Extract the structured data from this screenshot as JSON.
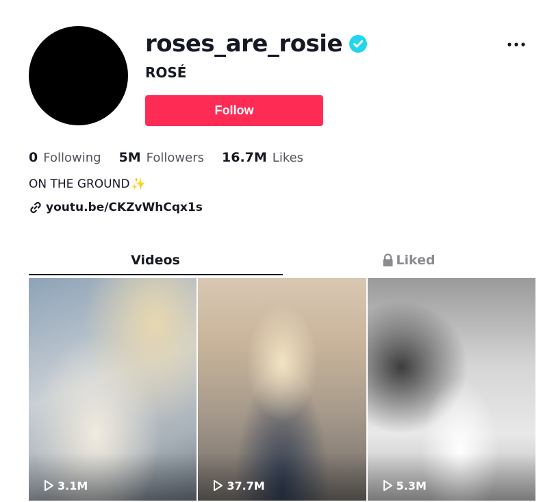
{
  "profile": {
    "username": "roses_are_rosie",
    "display_name": "ROSÉ",
    "verified": true,
    "follow_label": "Follow",
    "bio": "ON THE GROUND",
    "bio_emoji": "✨",
    "link": "youtu.be/CKZvWhCqx1s"
  },
  "stats": [
    {
      "value": "0",
      "label": "Following"
    },
    {
      "value": "5M",
      "label": "Followers"
    },
    {
      "value": "16.7M",
      "label": "Likes"
    }
  ],
  "tabs": [
    {
      "label": "Videos",
      "active": true
    },
    {
      "label": "Liked",
      "active": false,
      "locked": true
    }
  ],
  "videos": [
    {
      "views": "3.1M"
    },
    {
      "views": "37.7M"
    },
    {
      "views": "5.3M"
    }
  ],
  "colors": {
    "accent": "#fe2c55",
    "verified": "#20d5ec",
    "text": "#161823"
  },
  "icons": [
    "verified-badge-icon",
    "more-options-icon",
    "link-icon",
    "lock-icon",
    "play-icon"
  ]
}
